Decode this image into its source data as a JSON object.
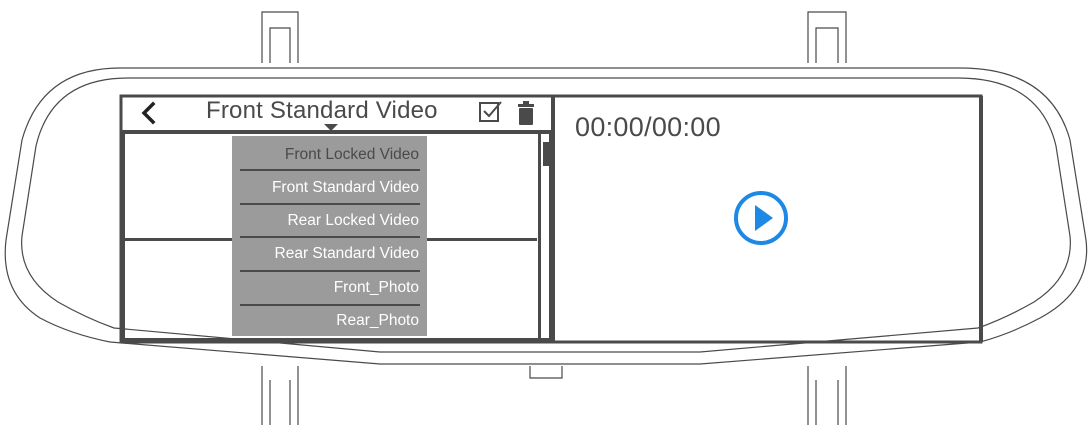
{
  "header": {
    "title": "Front Standard Video",
    "back_icon": "chevron-left-icon",
    "select_icon": "checkbox-icon",
    "delete_icon": "trash-icon"
  },
  "dropdown": {
    "items": [
      "Front Locked Video",
      "Front Standard Video",
      "Rear Locked Video",
      "Rear Standard Video",
      "Front_Photo",
      "Rear_Photo"
    ]
  },
  "player": {
    "time": "00:00/00:00",
    "play_icon": "play-circle-icon"
  },
  "colors": {
    "outline": "#4a4a4a",
    "dropdown_bg": "#9b9b9b",
    "accent": "#1e88e5"
  }
}
